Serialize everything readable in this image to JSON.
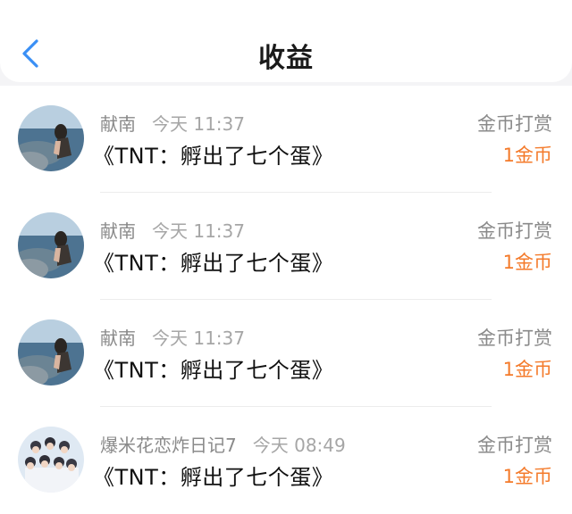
{
  "header": {
    "back_icon": "chevron-left-icon",
    "title": "收益"
  },
  "colors": {
    "accent": "#3a8ff5",
    "amount": "#f47a2a",
    "background_top": "#f4f4f6"
  },
  "records": [
    {
      "name": "献南",
      "time": "今天 11:37",
      "content": "《TNT：孵出了七个蛋》",
      "type": "金币打赏",
      "amount": "1金币"
    },
    {
      "name": "献南",
      "time": "今天 11:37",
      "content": "《TNT：孵出了七个蛋》",
      "type": "金币打赏",
      "amount": "1金币"
    },
    {
      "name": "献南",
      "time": "今天 11:37",
      "content": "《TNT：孵出了七个蛋》",
      "type": "金币打赏",
      "amount": "1金币"
    },
    {
      "name": "爆米花恋炸日记7",
      "time": "今天 08:49",
      "content": "《TNT：孵出了七个蛋》",
      "type": "金币打赏",
      "amount": "1金币"
    }
  ]
}
